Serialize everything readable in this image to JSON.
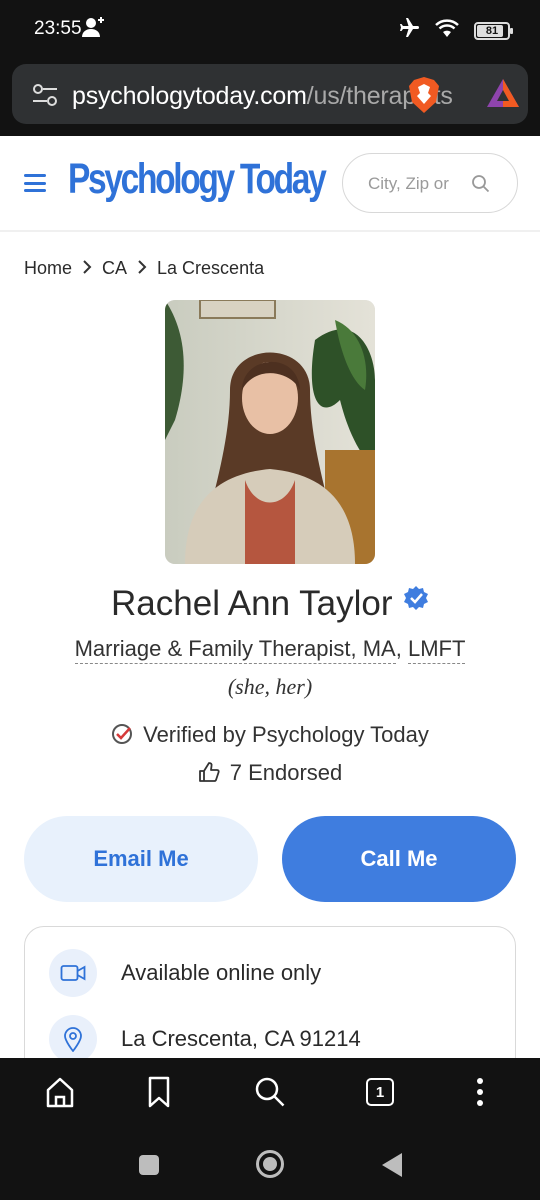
{
  "status_bar": {
    "time": "23:55",
    "battery": "81",
    "icons": [
      "person-add-icon",
      "airplane-icon",
      "wifi-icon",
      "battery-icon"
    ]
  },
  "browser": {
    "url_domain": "psychologytoday.com",
    "url_path": "/us/therapists",
    "tab_count": "1",
    "icons": [
      "tune-icon",
      "brave-shield-icon",
      "brave-rewards-icon",
      "home-icon",
      "bookmark-icon",
      "search-icon",
      "menu-dots-icon"
    ]
  },
  "header": {
    "logo": "Psychology Today",
    "search_placeholder": "City, Zip or"
  },
  "breadcrumb": [
    "Home",
    "CA",
    "La Crescenta"
  ],
  "profile": {
    "name": "Rachel Ann Taylor",
    "title_main": "Marriage & Family Therapist, MA",
    "title_sep": ", ",
    "title_lic": "LMFT",
    "pronouns": "(she, her)",
    "verified": "Verified by Psychology Today",
    "endorsed": "7 Endorsed"
  },
  "actions": {
    "email": "Email Me",
    "call": "Call Me"
  },
  "info": {
    "online": "Available online only",
    "location": "La Crescenta, CA 91214"
  },
  "colors": {
    "brand": "#2f72d8",
    "call_button": "#3f7ddf",
    "email_button_bg": "#e8f1fc",
    "verified_check": "#d63a3a"
  }
}
